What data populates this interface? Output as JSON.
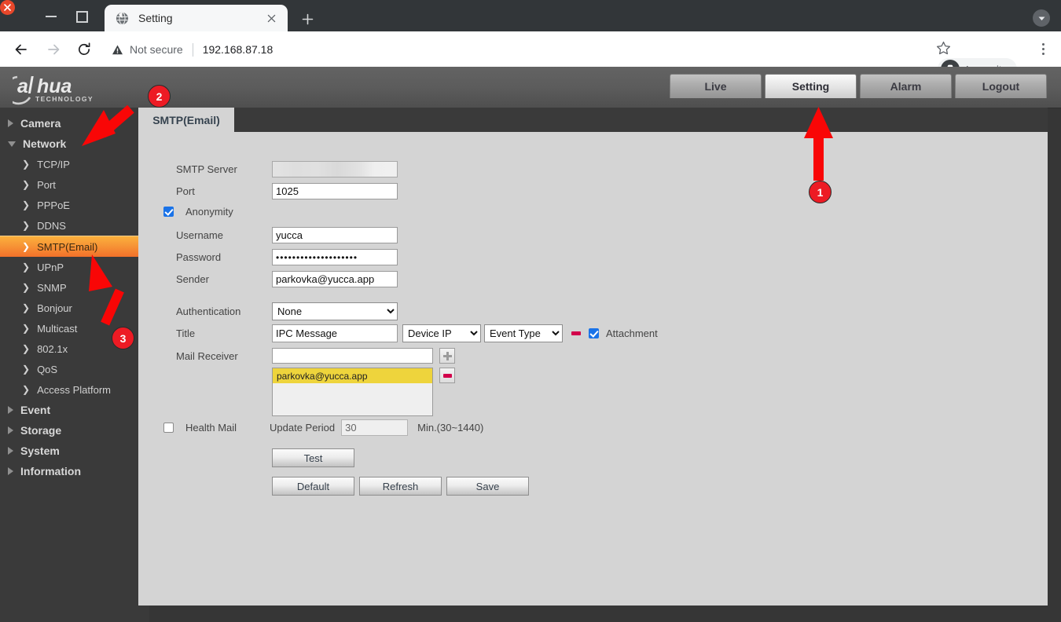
{
  "browser": {
    "tab_title": "Setting",
    "tab_favicon": "globe-icon",
    "security_label": "Not secure",
    "url": "192.168.87.18",
    "profile_label": "Incognito",
    "new_tab_label": "+"
  },
  "device_header": {
    "brand": "alhua",
    "brand_sub": "TECHNOLOGY",
    "nav_tabs": [
      {
        "label": "Live",
        "active": false
      },
      {
        "label": "Setting",
        "active": true
      },
      {
        "label": "Alarm",
        "active": false
      },
      {
        "label": "Logout",
        "active": false
      }
    ]
  },
  "sidebar": {
    "groups": [
      {
        "label": "Camera",
        "expanded": false
      },
      {
        "label": "Network",
        "expanded": true
      }
    ],
    "network_items": [
      {
        "label": "TCP/IP",
        "selected": false
      },
      {
        "label": "Port",
        "selected": false
      },
      {
        "label": "PPPoE",
        "selected": false
      },
      {
        "label": "DDNS",
        "selected": false
      },
      {
        "label": "SMTP(Email)",
        "selected": true
      },
      {
        "label": "UPnP",
        "selected": false
      },
      {
        "label": "SNMP",
        "selected": false
      },
      {
        "label": "Bonjour",
        "selected": false
      },
      {
        "label": "Multicast",
        "selected": false
      },
      {
        "label": "802.1x",
        "selected": false
      },
      {
        "label": "QoS",
        "selected": false
      },
      {
        "label": "Access Platform",
        "selected": false
      }
    ],
    "tail_groups": [
      {
        "label": "Event",
        "expanded": false
      },
      {
        "label": "Storage",
        "expanded": false
      },
      {
        "label": "System",
        "expanded": false
      },
      {
        "label": "Information",
        "expanded": false
      }
    ]
  },
  "content": {
    "tab_label": "SMTP(Email)",
    "fields": {
      "smtp_server_label": "SMTP Server",
      "smtp_server_value": "",
      "port_label": "Port",
      "port_value": "1025",
      "anonymity_label": "Anonymity",
      "anonymity_checked": true,
      "username_label": "Username",
      "username_value": "yucca",
      "password_label": "Password",
      "password_value": "••••••••••••••••••••",
      "sender_label": "Sender",
      "sender_value": "parkovka@yucca.app",
      "authentication_label": "Authentication",
      "authentication_value": "None",
      "title_label": "Title",
      "title_value": "IPC Message",
      "title_select1_value": "Device IP",
      "title_select2_value": "Event Type",
      "attachment_label": "Attachment",
      "attachment_checked": true,
      "mail_receiver_label": "Mail Receiver",
      "mail_receiver_input": "",
      "mail_receiver_list": [
        "parkovka@yucca.app"
      ],
      "add_icon": "plus-icon",
      "remove_icon": "minus-icon",
      "health_mail_label": "Health Mail",
      "health_mail_checked": false,
      "update_period_label": "Update Period",
      "update_period_value": "30",
      "update_period_hint": "Min.(30~1440)"
    },
    "buttons": {
      "test": "Test",
      "default": "Default",
      "refresh": "Refresh",
      "save": "Save"
    }
  },
  "annotations": {
    "accent_color": "#ed1b24",
    "markers": [
      {
        "id": "1",
        "target": "setting-tab"
      },
      {
        "id": "2",
        "target": "network-menu"
      },
      {
        "id": "3",
        "target": "smtp-email-menu"
      }
    ]
  }
}
